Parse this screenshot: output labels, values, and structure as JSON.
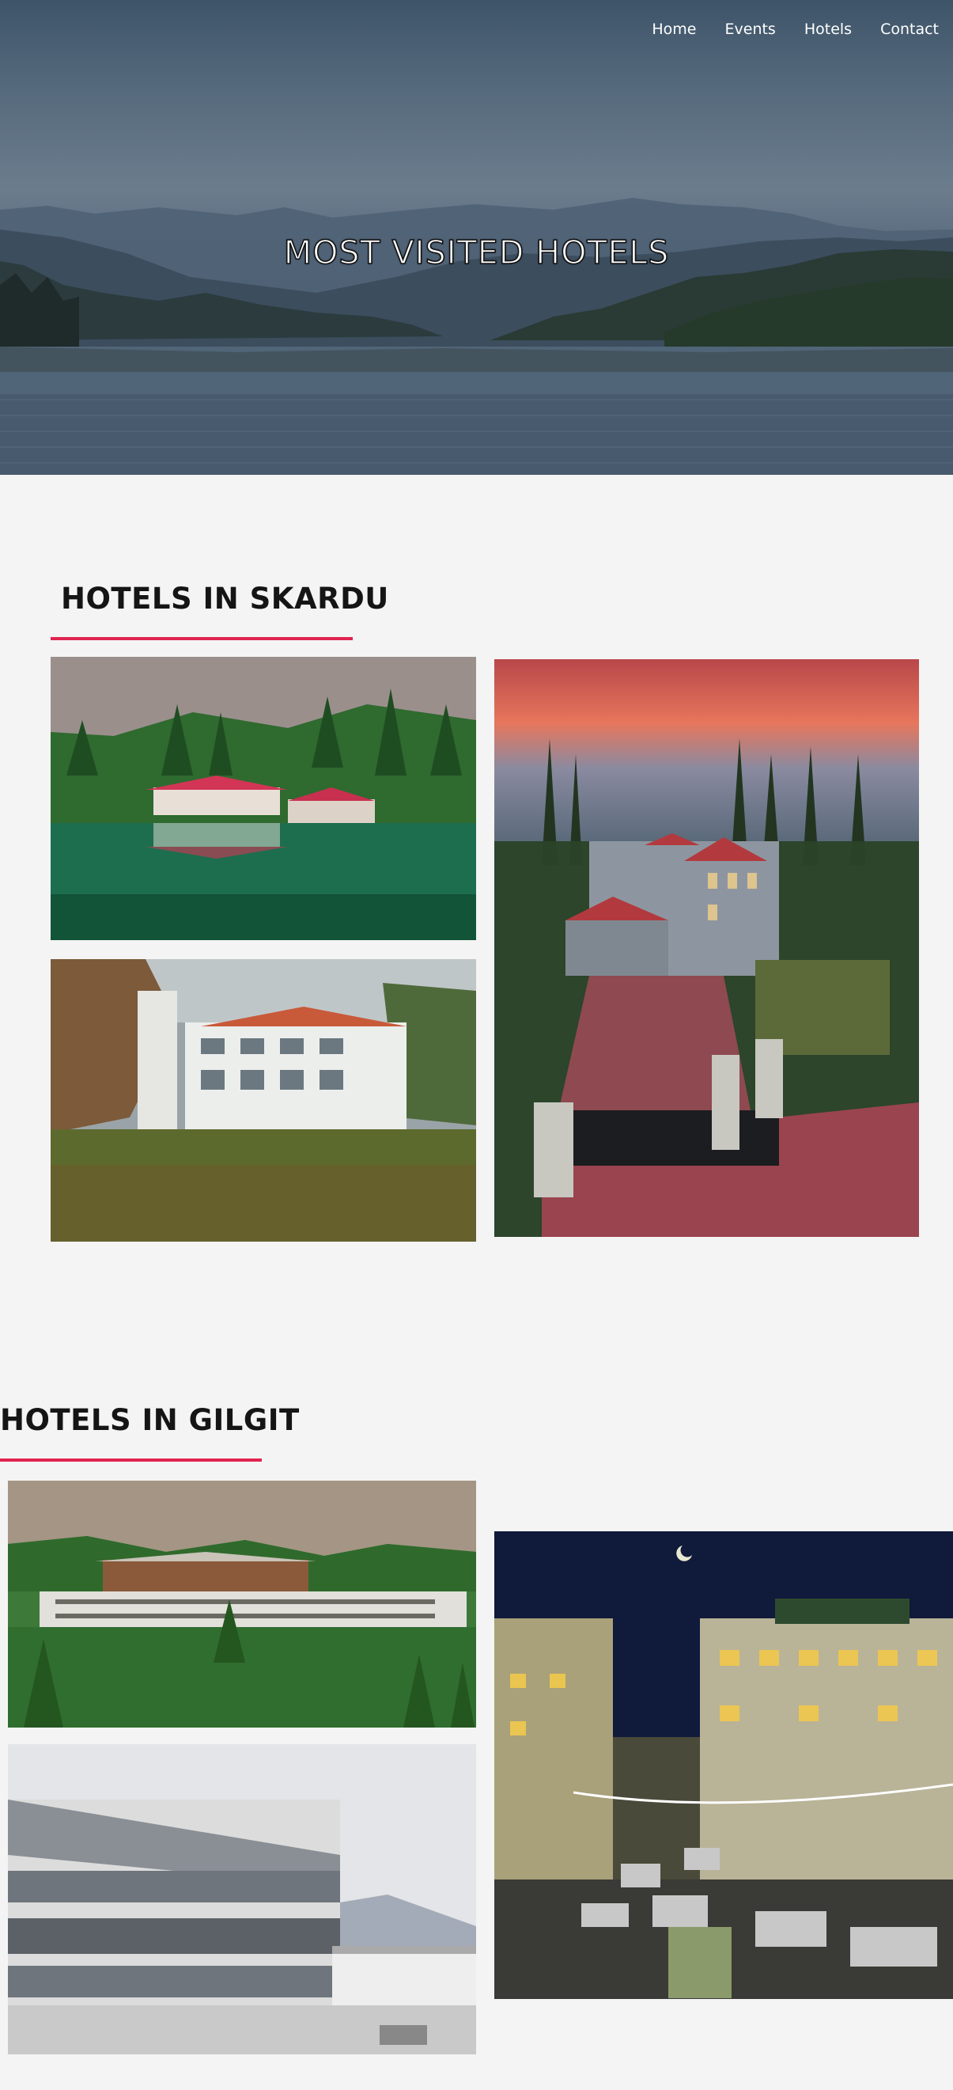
{
  "nav": {
    "items": [
      "Home",
      "Events",
      "Hotels",
      "Contact"
    ]
  },
  "hero": {
    "title": "MOST VISITED HOTELS"
  },
  "sections": [
    {
      "title": "HOTELS IN SKARDU"
    },
    {
      "title": "HOTELS IN GILGIT"
    }
  ],
  "colors": {
    "accent": "#e0244f",
    "background": "#f4f4f4",
    "heading": "#151515"
  }
}
